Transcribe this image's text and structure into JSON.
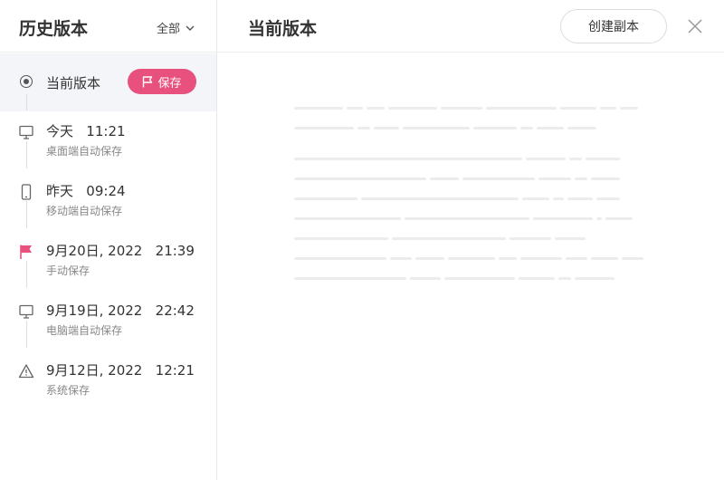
{
  "sidebar": {
    "title": "历史版本",
    "filter_label": "全部",
    "current": {
      "label": "当前版本",
      "save_label": "保存"
    },
    "versions": [
      {
        "icon": "monitor-icon",
        "title": "今天   11:21",
        "subtitle": "桌面端自动保存"
      },
      {
        "icon": "phone-icon",
        "title": "昨天   09:24",
        "subtitle": "移动端自动保存"
      },
      {
        "icon": "flag-icon",
        "title": "9月20日, 2022   21:39",
        "subtitle": "手动保存"
      },
      {
        "icon": "monitor-icon",
        "title": "9月19日, 2022   22:42",
        "subtitle": "电脑端自动保存"
      },
      {
        "icon": "warning-icon",
        "title": "9月12日, 2022   12:21",
        "subtitle": "系统保存"
      }
    ]
  },
  "main": {
    "title": "当前版本",
    "copy_label": "创建副本"
  },
  "colors": {
    "accent": "#e8517e",
    "selected_bg": "#f3f5f9",
    "placeholder_line": "#ececec"
  }
}
